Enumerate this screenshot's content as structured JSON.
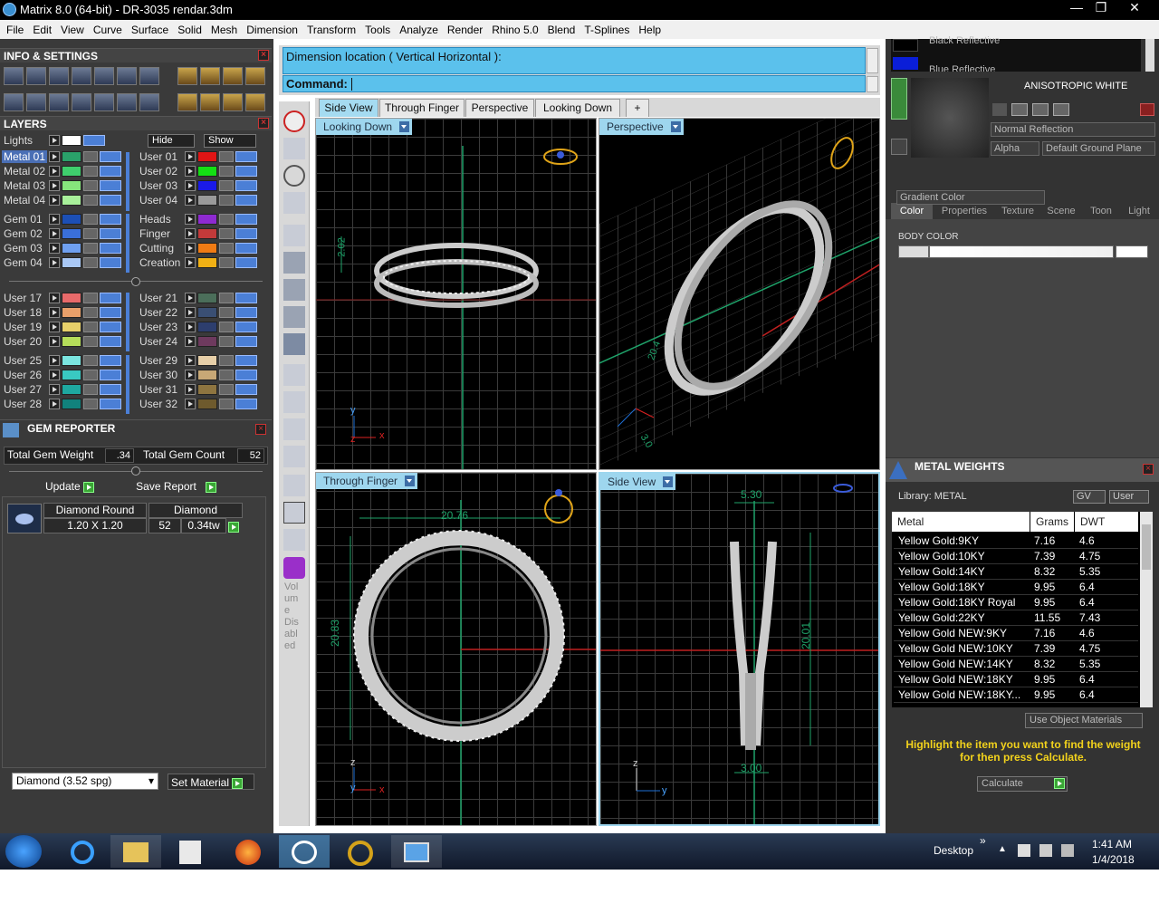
{
  "window": {
    "title": "Matrix 8.0 (64-bit) - DR-3035 rendar.3dm",
    "minimize_glyph": "—",
    "maximize_glyph": "❐",
    "close_glyph": "✕"
  },
  "menu": [
    "File",
    "Edit",
    "View",
    "Curve",
    "Surface",
    "Solid",
    "Mesh",
    "Dimension",
    "Transform",
    "Tools",
    "Analyze",
    "Render",
    "Rhino 5.0",
    "Blend",
    "T-Splines",
    "Help"
  ],
  "left": {
    "info_title": "INFO & SETTINGS",
    "layers_title": "LAYERS",
    "lights_label": "Lights",
    "hide_label": "Hide",
    "show_label": "Show",
    "layers_left": [
      {
        "name": "Metal 01",
        "color": "#2aa16a",
        "selected": true
      },
      {
        "name": "Metal 02",
        "color": "#3fcf6d",
        "selected": false
      },
      {
        "name": "Metal 03",
        "color": "#86e57c",
        "selected": false
      },
      {
        "name": "Metal 04",
        "color": "#a8f09a",
        "selected": false
      },
      {
        "name": "Gem 01",
        "color": "#1c4fb5",
        "selected": false
      },
      {
        "name": "Gem 02",
        "color": "#3a6fd9",
        "selected": false
      },
      {
        "name": "Gem 03",
        "color": "#6fa0f0",
        "selected": false
      },
      {
        "name": "Gem 04",
        "color": "#a9c8f5",
        "selected": false
      },
      {
        "name": "User 17",
        "color": "#e86a6a",
        "selected": false
      },
      {
        "name": "User 18",
        "color": "#e9a06a",
        "selected": false
      },
      {
        "name": "User 19",
        "color": "#e7d06a",
        "selected": false
      },
      {
        "name": "User 20",
        "color": "#b6dd5a",
        "selected": false
      },
      {
        "name": "User 25",
        "color": "#7be5e0",
        "selected": false
      },
      {
        "name": "User 26",
        "color": "#39c9c2",
        "selected": false
      },
      {
        "name": "User 27",
        "color": "#1ea8a0",
        "selected": false
      },
      {
        "name": "User 28",
        "color": "#11827c",
        "selected": false
      }
    ],
    "layers_right": [
      {
        "name": "User 01",
        "color": "#e01515"
      },
      {
        "name": "User 02",
        "color": "#14e014"
      },
      {
        "name": "User 03",
        "color": "#1a1ae8"
      },
      {
        "name": "User 04",
        "color": "#9a9a9a"
      },
      {
        "name": "Heads",
        "color": "#8e2ad1"
      },
      {
        "name": "Finger",
        "color": "#c33a3a"
      },
      {
        "name": "Cutting",
        "color": "#f07b14"
      },
      {
        "name": "Creation",
        "color": "#f0b014"
      },
      {
        "name": "User 21",
        "color": "#4b6e5a"
      },
      {
        "name": "User 22",
        "color": "#3a4f73"
      },
      {
        "name": "User 23",
        "color": "#2d3e6e"
      },
      {
        "name": "User 24",
        "color": "#6e3a5e"
      },
      {
        "name": "User 29",
        "color": "#e7cfa8"
      },
      {
        "name": "User 30",
        "color": "#c8a876"
      },
      {
        "name": "User 31",
        "color": "#8e7540"
      },
      {
        "name": "User 32",
        "color": "#6e5a2d"
      }
    ],
    "gem_reporter": {
      "title": "GEM REPORTER",
      "total_weight_label": "Total Gem Weight",
      "total_weight_value": ".34",
      "total_count_label": "Total Gem Count",
      "total_count_value": "52",
      "update_label": "Update",
      "save_label": "Save Report",
      "col1": "Diamond Round",
      "col2": "Diamond",
      "size": "1.20 X 1.20",
      "count": "52",
      "tw": "0.34tw",
      "material_select": "Diamond    (3.52 spg)",
      "set_material_label": "Set Material"
    }
  },
  "command": {
    "prompt": "Dimension location ( Vertical  Horizontal ):",
    "label": "Command:"
  },
  "tabs": [
    "Side View",
    "Through Finger",
    "Perspective",
    "Looking Down"
  ],
  "add_tab_glyph": "+",
  "viewports": {
    "tl_label": "Looking Down",
    "tr_label": "Perspective",
    "bl_label": "Through Finger",
    "br_label": "Side View",
    "dims": {
      "tl_vert": "2.02",
      "bl_width": "20.76",
      "bl_height": "20.83",
      "br_top": "5.30",
      "br_height": "20.01",
      "br_bottom": "3.00",
      "tr_a": "20.4",
      "tr_b": "3.0"
    },
    "axis": {
      "x": "x",
      "y": "y",
      "z": "z"
    }
  },
  "vtool_text": [
    "Vol",
    "um",
    "e",
    "Dis",
    "abl",
    "ed"
  ],
  "right": {
    "top_item1": "Black Reflective",
    "top_item2": "Blue Reflective",
    "material_name": "ANISOTROPIC WHITE",
    "reflection": "Normal Reflection",
    "alpha": "Alpha",
    "ground_plane": "Default Ground Plane",
    "tabs": [
      "Color",
      "Properties",
      "Texture",
      "Scene",
      "Toon",
      "Light"
    ],
    "gradient_select": "Gradient Color",
    "body_color_label": "BODY COLOR",
    "metal_weights_title": "METAL WEIGHTS",
    "library_label": "Library: METAL",
    "gv_label": "GV",
    "user_label": "User",
    "col_metal": "Metal",
    "col_grams": "Grams",
    "col_dwt": "DWT",
    "metals": [
      {
        "name": "Yellow Gold:9KY",
        "grams": "7.16",
        "dwt": "4.6"
      },
      {
        "name": "Yellow Gold:10KY",
        "grams": "7.39",
        "dwt": "4.75"
      },
      {
        "name": "Yellow Gold:14KY",
        "grams": "8.32",
        "dwt": "5.35"
      },
      {
        "name": "Yellow Gold:18KY",
        "grams": "9.95",
        "dwt": "6.4"
      },
      {
        "name": "Yellow Gold:18KY Royal",
        "grams": "9.95",
        "dwt": "6.4"
      },
      {
        "name": "Yellow Gold:22KY",
        "grams": "11.55",
        "dwt": "7.43"
      },
      {
        "name": "Yellow Gold NEW:9KY",
        "grams": "7.16",
        "dwt": "4.6"
      },
      {
        "name": "Yellow Gold NEW:10KY",
        "grams": "7.39",
        "dwt": "4.75"
      },
      {
        "name": "Yellow Gold NEW:14KY",
        "grams": "8.32",
        "dwt": "5.35"
      },
      {
        "name": "Yellow Gold NEW:18KY",
        "grams": "9.95",
        "dwt": "6.4"
      },
      {
        "name": "Yellow Gold NEW:18KY...",
        "grams": "9.95",
        "dwt": "6.4"
      }
    ],
    "use_object_materials": "Use Object Materials",
    "hint": "Highlight the item you want to find the weight for then press Calculate.",
    "calculate": "Calculate"
  },
  "taskbar": {
    "desktop_label": "Desktop",
    "expand_glyph": "»",
    "time": "1:41 AM",
    "date": "1/4/2018"
  },
  "colors": {
    "accent_blue": "#5bc1ec",
    "hint_yellow": "#f2d21c",
    "axis_red": "#e02020",
    "dim_green": "#1fa36a"
  }
}
